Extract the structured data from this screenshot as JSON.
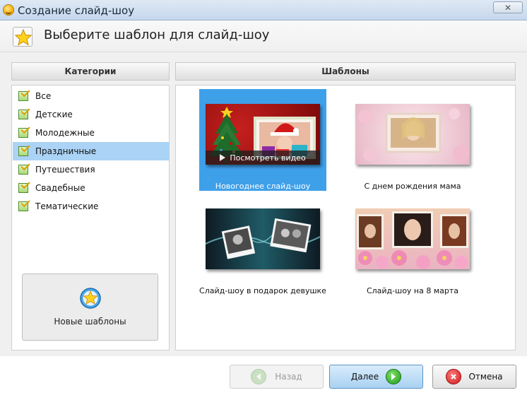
{
  "window": {
    "title": "Создание слайд-шоу",
    "close_label": "✕"
  },
  "header": {
    "title": "Выберите шаблон для слайд-шоу"
  },
  "categories": {
    "heading": "Категории",
    "items": [
      {
        "label": "Все"
      },
      {
        "label": "Детские"
      },
      {
        "label": "Молодежные"
      },
      {
        "label": "Праздничные",
        "selected": true
      },
      {
        "label": "Путешествия"
      },
      {
        "label": "Свадебные"
      },
      {
        "label": "Тематические"
      }
    ],
    "new_templates_label": "Новые шаблоны"
  },
  "templates": {
    "heading": "Шаблоны",
    "items": [
      {
        "label": "Новогоднее слайд-шоу",
        "selected": true,
        "overlay": "Посмотреть видео"
      },
      {
        "label": "С днем рождения мама"
      },
      {
        "label": "Слайд-шоу в подарок девушке"
      },
      {
        "label": "Слайд-шоу на 8 марта"
      }
    ]
  },
  "footer": {
    "back_label": "Назад",
    "next_label": "Далее",
    "cancel_label": "Отмена"
  },
  "colors": {
    "selection": "#3fa0ea",
    "category_selection": "#aad3f5",
    "accent_green": "#1f9a1b",
    "accent_red": "#cc1a1a"
  }
}
